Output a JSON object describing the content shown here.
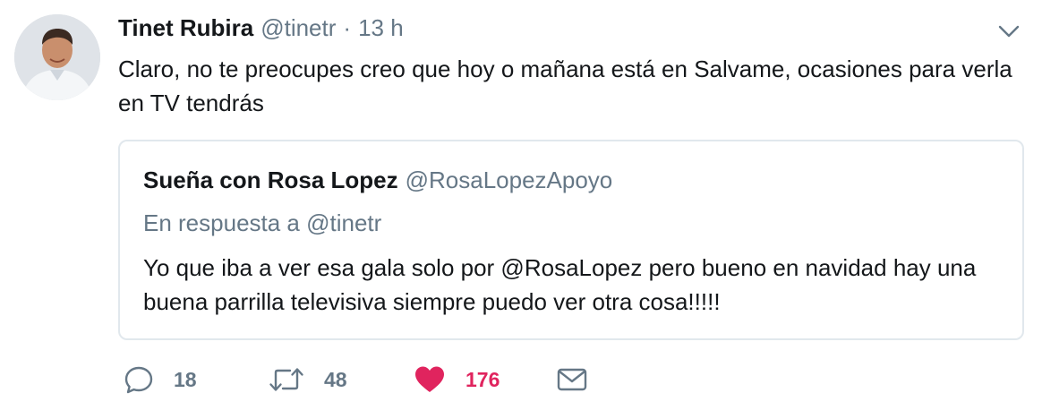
{
  "author": {
    "display_name": "Tinet Rubira",
    "handle": "@tinetr",
    "separator": "·",
    "time": "13 h"
  },
  "tweet_text": "Claro, no te preocupes creo que hoy o mañana está en Salvame, ocasiones para verla en TV tendrás",
  "quoted": {
    "display_name": "Sueña con Rosa Lopez",
    "handle": "@RosaLopezApoyo",
    "reply_context": "En respuesta a @tinetr",
    "text": "Yo que iba a ver esa gala solo por @RosaLopez pero bueno en navidad hay una buena parrilla televisiva siempre puedo ver otra cosa!!!!!"
  },
  "actions": {
    "replies": "18",
    "retweets": "48",
    "likes": "176",
    "liked": true,
    "icons": [
      "reply-icon",
      "retweet-icon",
      "heart-icon",
      "message-icon"
    ]
  },
  "colors": {
    "text": "#14171a",
    "secondary": "#657786",
    "border": "#e1e8ed",
    "like": "#e0245e"
  }
}
